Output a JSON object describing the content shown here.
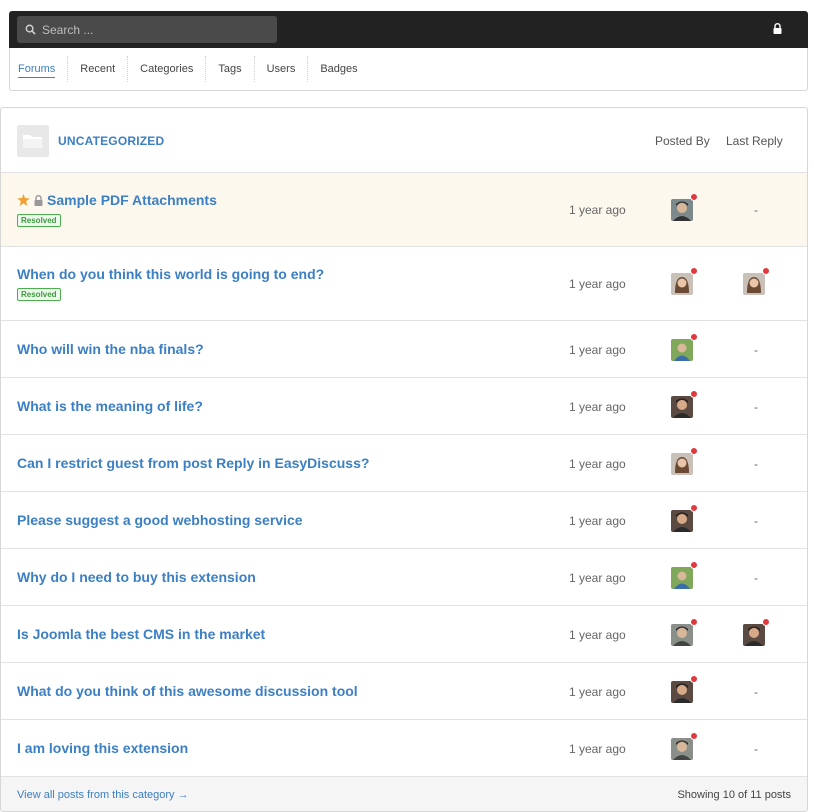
{
  "search": {
    "placeholder": "Search ..."
  },
  "nav": [
    {
      "label": "Forums",
      "active": true
    },
    {
      "label": "Recent"
    },
    {
      "label": "Categories"
    },
    {
      "label": "Tags"
    },
    {
      "label": "Users"
    },
    {
      "label": "Badges"
    }
  ],
  "category": {
    "title": "UNCATEGORIZED",
    "posted_by_label": "Posted By",
    "last_reply_label": "Last Reply"
  },
  "posts": [
    {
      "title": "Sample PDF Attachments",
      "featured": true,
      "locked": true,
      "badge": "Resolved",
      "time": "1 year ago",
      "poster_avatar": "male-avatar",
      "last_reply": "-"
    },
    {
      "title": "When do you think this world is going to end?",
      "badge": "Resolved",
      "time": "1 year ago",
      "poster_avatar": "female-avatar",
      "last_reply_avatar": "female-avatar"
    },
    {
      "title": "Who will win the nba finals?",
      "time": "1 year ago",
      "poster_avatar": "outdoor-avatar",
      "last_reply": "-"
    },
    {
      "title": "What is the meaning of life?",
      "time": "1 year ago",
      "poster_avatar": "male-avatar",
      "last_reply": "-"
    },
    {
      "title": "Can I restrict guest from post Reply in EasyDiscuss?",
      "time": "1 year ago",
      "poster_avatar": "female-avatar",
      "last_reply": "-"
    },
    {
      "title": "Please suggest a good webhosting service",
      "time": "1 year ago",
      "poster_avatar": "male-avatar",
      "last_reply": "-"
    },
    {
      "title": "Why do I need to buy this extension",
      "time": "1 year ago",
      "poster_avatar": "outdoor-avatar",
      "last_reply": "-"
    },
    {
      "title": "Is Joomla the best CMS in the market",
      "time": "1 year ago",
      "poster_avatar": "male-avatar",
      "last_reply_avatar": "male-avatar"
    },
    {
      "title": "What do you think of this awesome discussion tool",
      "time": "1 year ago",
      "poster_avatar": "male-avatar",
      "last_reply": "-"
    },
    {
      "title": "I am loving this extension",
      "time": "1 year ago",
      "poster_avatar": "male-avatar",
      "last_reply": "-"
    }
  ],
  "footer": {
    "view_all": "View all posts from this category →",
    "showing": "Showing 10 of 11 posts"
  },
  "colors": {
    "link": "#3b7fc4",
    "status_dot": "#e0393e",
    "featured_bg": "#fdf8ee",
    "star": "#f0a030"
  }
}
